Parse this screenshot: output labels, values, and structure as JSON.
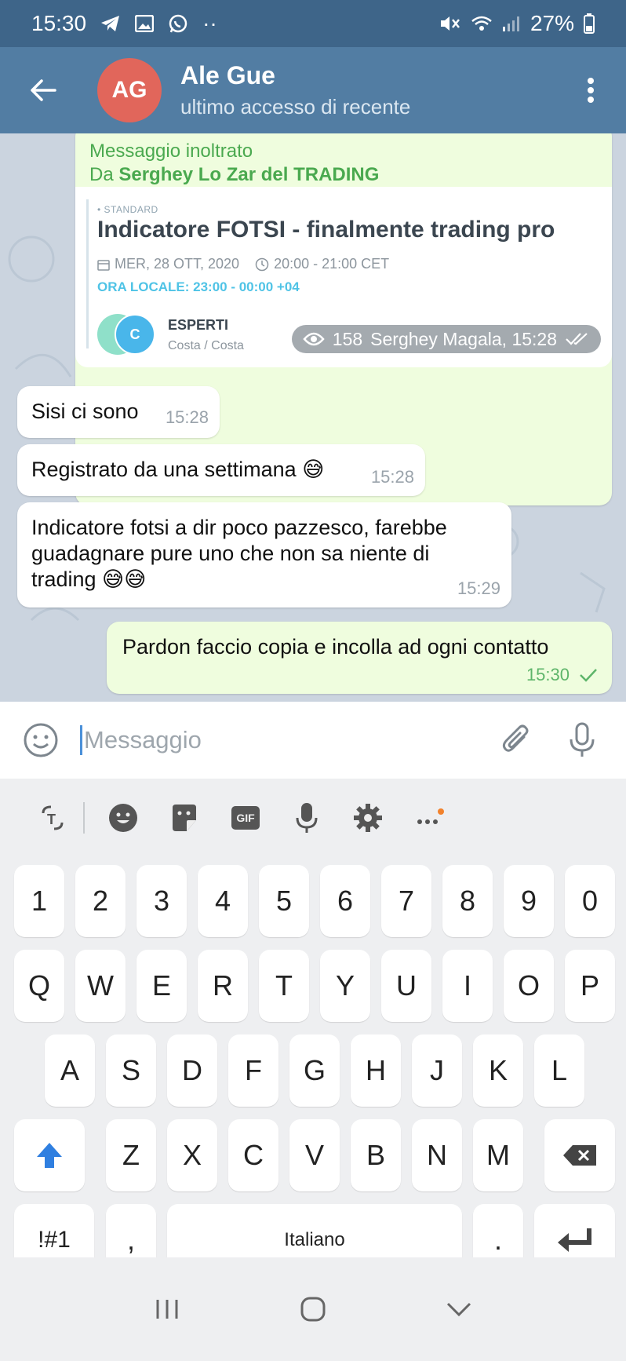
{
  "status_bar": {
    "time": "15:30",
    "battery": "27%"
  },
  "header": {
    "avatar_initials": "AG",
    "contact_name": "Ale Gue",
    "last_seen": "ultimo accesso di recente",
    "avatar_color": "#e1665b",
    "bar_color": "#527da3"
  },
  "forwarded": {
    "label": "Messaggio inoltrato",
    "from_prefix": "Da ",
    "from_name": "Serghey Lo Zar del TRADING",
    "card": {
      "tag": "• STANDARD",
      "title": "Indicatore FOTSI - finalmente trading pro",
      "date": "MER, 28 OTT, 2020",
      "time_range": "20:00 - 21:00 CET",
      "local_time": "ORA LOCALE: 23:00 - 00:00 +04",
      "organizer": "ESPERTI",
      "location": "Costa / Costa",
      "avatar_letter": "C"
    },
    "views": "158",
    "author_time": "Serghey Magala, 15:28"
  },
  "messages": [
    {
      "text": "Sisi ci sono",
      "time": "15:28"
    },
    {
      "text": "Registrato da una settimana 😅",
      "time": "15:28"
    },
    {
      "line1": "Indicatore fotsi a dir poco pazzesco, farebbe",
      "line2": "guadagnare pure uno che non sa niente di",
      "line3": "trading 😅😅",
      "time": "15:29"
    },
    {
      "text": "Pardon faccio copia e incolla ad ogni contatto",
      "time": "15:30"
    }
  ],
  "composer": {
    "placeholder": "Messaggio"
  },
  "keyboard": {
    "row_numbers": [
      "1",
      "2",
      "3",
      "4",
      "5",
      "6",
      "7",
      "8",
      "9",
      "0"
    ],
    "row1": [
      "Q",
      "W",
      "E",
      "R",
      "T",
      "Y",
      "U",
      "I",
      "O",
      "P"
    ],
    "row2": [
      "A",
      "S",
      "D",
      "F",
      "G",
      "H",
      "J",
      "K",
      "L"
    ],
    "row3": [
      "Z",
      "X",
      "C",
      "V",
      "B",
      "N",
      "M"
    ],
    "symbols_key": "!#1",
    "comma_key": ",",
    "space_label": "Italiano",
    "period_key": ".",
    "gif_label": "GIF"
  }
}
